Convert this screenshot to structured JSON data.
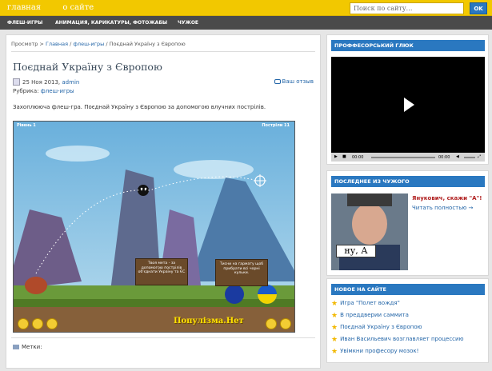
{
  "header": {
    "nav": [
      "главная",
      "о сайте"
    ],
    "search_placeholder": "Поиск по сайту…",
    "search_button": "OK"
  },
  "categories": [
    "ФЛЕШ-ИГРЫ",
    "АНИМАЦИЯ, КАРИКАТУРЫ, ФОТОЖАБЫ",
    "ЧУЖОЕ"
  ],
  "post": {
    "breadcrumb": {
      "root": "Просмотр",
      "sep": " > ",
      "link1": "Главная",
      "link2": "флеш-игры",
      "current": "Поєднай Україну з Європою"
    },
    "title": "Поєднай Україну з Європою",
    "date": "25 Ноя 2013,",
    "author": "admin",
    "reviews": "Ваш отзыв",
    "rubric_label": "Рубрика:",
    "rubric": "флеш-игры",
    "intro": "Захоплююча флеш-гра. Поєднай Україну з Європою за допомогою влучних пострілів.",
    "tags_label": "Метки:"
  },
  "game": {
    "level": "Рівень 1",
    "shots": "Постріли 11",
    "sign1": "Твоя мета - за допомогою пострілів об'єднати Україну та ЄС",
    "sign2": "Тисни на гармату щоб прибрати всі чорні кульки.",
    "site": "Популізма.Нет"
  },
  "sidebar": {
    "video_title": "ПРОФФЕСОРСЬКИЙ ГЛЮК",
    "video_time_left": "00:00",
    "video_time_right": "00:00",
    "news_title": "ПОСЛЕДНЕЕ ИЗ ЧУЖОГО",
    "news_item_title": "Янукович, скажи \"А\"!",
    "news_item_more": "Читать полностью →",
    "news_caption": "ну, А",
    "new_title": "НОВОЕ НА САЙТЕ",
    "new_items": [
      "Игра \"Полет вождя\"",
      "В преддверии саммита",
      "Поєднай Україну з Європою",
      "Иван Васильевич возглавляет процессию",
      "Увімкни професору мозок!"
    ]
  },
  "colors": {
    "topbar": "#f2c800",
    "catbar": "#4a4a4a",
    "accent": "#2a78c0",
    "link": "#2466a8"
  }
}
